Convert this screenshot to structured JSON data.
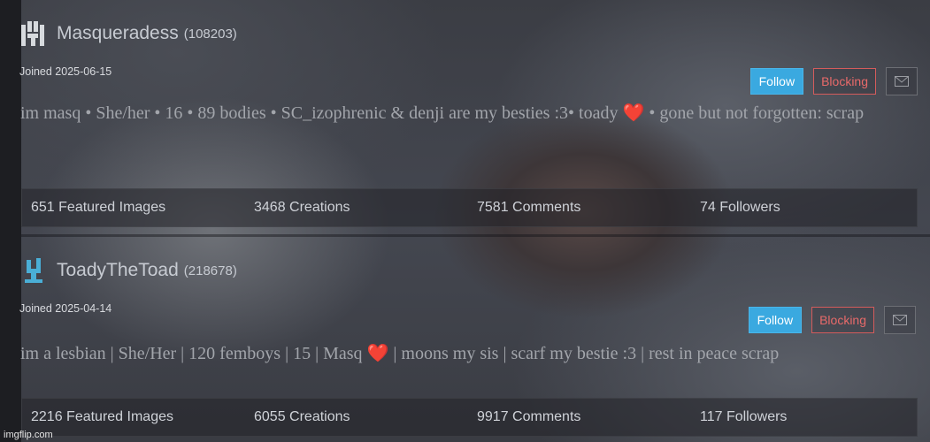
{
  "profiles": [
    {
      "username": "Masqueradess",
      "uid": "(108203)",
      "joined": "Joined 2025-06-15",
      "follow_label": "Follow",
      "blocking_label": "Blocking",
      "bio_before_heart": "im masq • She/her • 16 • 89 bodies • SC_izophrenic & denji are my besties :3• toady ",
      "bio_heart": "❤️",
      "bio_after_heart": " • gone but not forgotten: scrap",
      "stats": {
        "featured": "651 Featured Images",
        "creations": "3468 Creations",
        "comments": "7581 Comments",
        "followers": "74 Followers"
      }
    },
    {
      "username": "ToadyTheToad",
      "uid": "(218678)",
      "joined": "Joined 2025-04-14",
      "follow_label": "Follow",
      "blocking_label": "Blocking",
      "bio_before_heart": "im a lesbian | She/Her | 120 femboys | 15 | Masq ",
      "bio_heart": "❤️",
      "bio_after_heart": " | moons my sis | scarf my bestie :3 | rest in peace scrap",
      "stats": {
        "featured": "2216 Featured Images",
        "creations": "6055 Creations",
        "comments": "9917 Comments",
        "followers": "117 Followers"
      }
    }
  ],
  "watermark": "imgflip.com",
  "colors": {
    "follow": "#3aa9e0",
    "blocking": "#e86a6a",
    "avatar1": "#d7dade",
    "avatar2": "#4aaed6"
  },
  "icons": {
    "avatar1": "avatar-icon",
    "avatar2": "avatar-icon",
    "mail": "mail-icon"
  }
}
